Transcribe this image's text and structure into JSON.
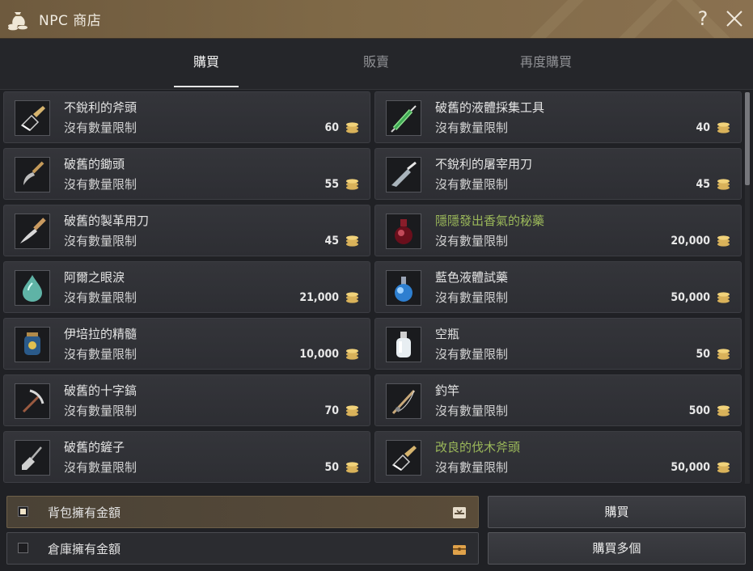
{
  "window": {
    "title": "NPC 商店",
    "icon": "money-bag-icon",
    "help_label": "?",
    "close_icon": "close-icon"
  },
  "tabs": [
    {
      "label": "購買",
      "active": true
    },
    {
      "label": "販賣",
      "active": false
    },
    {
      "label": "再度購買",
      "active": false
    }
  ],
  "items": [
    {
      "name": "不銳利的斧頭",
      "limit": "沒有數量限制",
      "price": "60",
      "icon": "axe-head-icon",
      "highlight": false
    },
    {
      "name": "破舊的液體採集工具",
      "limit": "沒有數量限制",
      "price": "40",
      "icon": "syringe-icon",
      "highlight": false
    },
    {
      "name": "破舊的鋤頭",
      "limit": "沒有數量限制",
      "price": "55",
      "icon": "hoe-icon",
      "highlight": false
    },
    {
      "name": "不銳利的屠宰用刀",
      "limit": "沒有數量限制",
      "price": "45",
      "icon": "butcher-knife-icon",
      "highlight": false
    },
    {
      "name": "破舊的製革用刀",
      "limit": "沒有數量限制",
      "price": "45",
      "icon": "tanning-knife-icon",
      "highlight": false
    },
    {
      "name": "隱隱發出香氣的秘藥",
      "limit": "沒有數量限制",
      "price": "20,000",
      "icon": "red-potion-icon",
      "highlight": true
    },
    {
      "name": "阿爾之眼淚",
      "limit": "沒有數量限制",
      "price": "21,000",
      "icon": "teardrop-icon",
      "highlight": false
    },
    {
      "name": "藍色液體試藥",
      "limit": "沒有數量限制",
      "price": "50,000",
      "icon": "blue-flask-icon",
      "highlight": false
    },
    {
      "name": "伊培拉的精髓",
      "limit": "沒有數量限制",
      "price": "10,000",
      "icon": "essence-jar-icon",
      "highlight": false
    },
    {
      "name": "空瓶",
      "limit": "沒有數量限制",
      "price": "50",
      "icon": "empty-bottle-icon",
      "highlight": false
    },
    {
      "name": "破舊的十字鎬",
      "limit": "沒有數量限制",
      "price": "70",
      "icon": "pickaxe-icon",
      "highlight": false
    },
    {
      "name": "釣竿",
      "limit": "沒有數量限制",
      "price": "500",
      "icon": "fishing-rod-icon",
      "highlight": false
    },
    {
      "name": "破舊的鏟子",
      "limit": "沒有數量限制",
      "price": "50",
      "icon": "shovel-icon",
      "highlight": false
    },
    {
      "name": "改良的伐木斧頭",
      "limit": "沒有數量限制",
      "price": "50,000",
      "icon": "axe-head-icon",
      "highlight": true
    }
  ],
  "payment": [
    {
      "label": "背包擁有金額",
      "selected": true,
      "icon": "inventory-icon"
    },
    {
      "label": "倉庫擁有金額",
      "selected": false,
      "icon": "storage-chest-icon"
    }
  ],
  "buttons": {
    "buy": "購買",
    "buy_multiple": "購買多個"
  },
  "colors": {
    "highlight_name": "#9bb85a",
    "title_bar": "#7f6947",
    "coin": "#d9b25a"
  }
}
